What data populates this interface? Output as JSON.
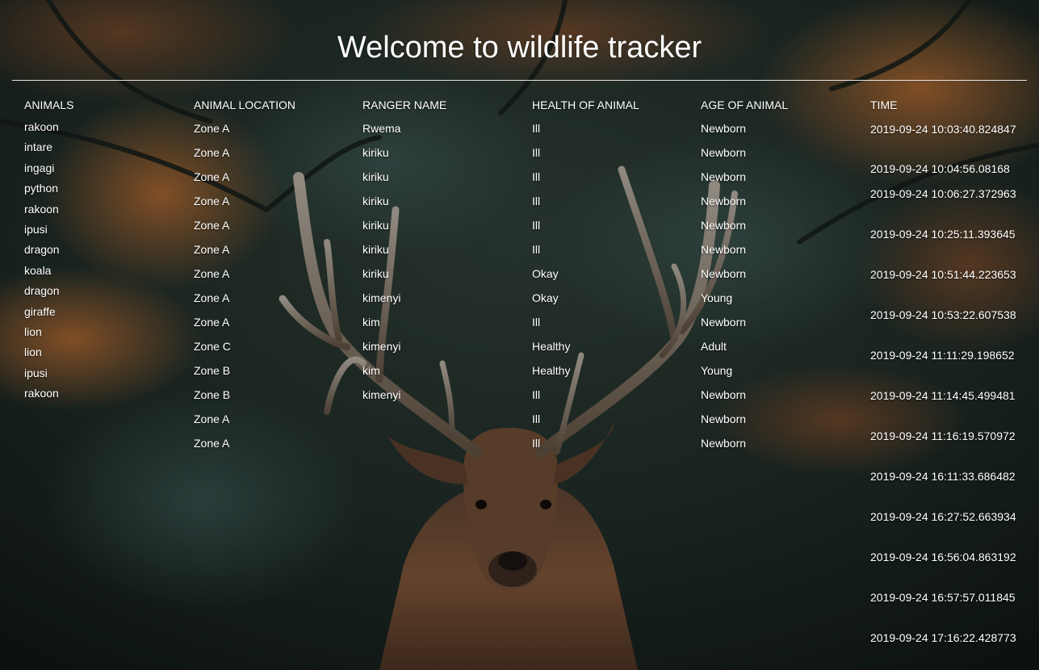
{
  "page": {
    "title": "Welcome to wildlife tracker"
  },
  "columns": {
    "animals": "ANIMALS",
    "location": "ANIMAL LOCATION",
    "ranger": "RANGER NAME",
    "health": "HEALTH OF ANIMAL",
    "age": "AGE OF ANIMAL",
    "time": "TIME"
  },
  "animals": [
    "rakoon",
    "intare",
    "ingagi",
    "python",
    "rakoon",
    "ipusi",
    "dragon",
    "koala",
    "dragon",
    "giraffe",
    "lion",
    "lion",
    "ipusi",
    "rakoon"
  ],
  "sightings": [
    {
      "location": "Zone A",
      "ranger": "Rwema",
      "health": "Ill",
      "age": "Newborn"
    },
    {
      "location": "Zone A",
      "ranger": "kiriku",
      "health": "Ill",
      "age": "Newborn"
    },
    {
      "location": "Zone A",
      "ranger": "kiriku",
      "health": "Ill",
      "age": "Newborn"
    },
    {
      "location": "Zone A",
      "ranger": "kiriku",
      "health": "Ill",
      "age": "Newborn"
    },
    {
      "location": "Zone A",
      "ranger": "kiriku",
      "health": "Ill",
      "age": "Newborn"
    },
    {
      "location": "Zone A",
      "ranger": "kiriku",
      "health": "Ill",
      "age": "Newborn"
    },
    {
      "location": "Zone A",
      "ranger": "kiriku",
      "health": "Okay",
      "age": "Newborn"
    },
    {
      "location": "Zone A",
      "ranger": "kimenyi",
      "health": "Okay",
      "age": "Young"
    },
    {
      "location": "Zone A",
      "ranger": "kim",
      "health": "Ill",
      "age": "Newborn"
    },
    {
      "location": "Zone C",
      "ranger": "kimenyi",
      "health": "Healthy",
      "age": "Adult"
    },
    {
      "location": "Zone B",
      "ranger": "kim",
      "health": "Healthy",
      "age": "Young"
    },
    {
      "location": "Zone B",
      "ranger": "kimenyi",
      "health": "Ill",
      "age": "Newborn"
    },
    {
      "location": "Zone A",
      "ranger": "",
      "health": "Ill",
      "age": "Newborn"
    },
    {
      "location": "Zone A",
      "ranger": "",
      "health": "Ill",
      "age": "Newborn"
    }
  ],
  "times": [
    "2019-09-24 10:03:40.824847",
    "2019-09-24 10:04:56.08168",
    "2019-09-24 10:06:27.372963",
    "2019-09-24 10:25:11.393645",
    "2019-09-24 10:51:44.223653",
    "2019-09-24 10:53:22.607538",
    "2019-09-24 11:11:29.198652",
    "2019-09-24 11:14:45.499481",
    "2019-09-24 11:16:19.570972",
    "2019-09-24 16:11:33.686482",
    "2019-09-24 16:27:52.663934",
    "2019-09-24 16:56:04.863192",
    "2019-09-24 16:57:57.011845",
    "2019-09-24 17:16:22.428773"
  ],
  "colors": {
    "text": "#ffffff",
    "rule": "#e6e6e6",
    "forest_dark": "#16201d",
    "foliage_orange": "#a8622c",
    "deer_brown": "#6e4a32"
  },
  "background_image": "deer-with-antlers-in-autumn-forest"
}
